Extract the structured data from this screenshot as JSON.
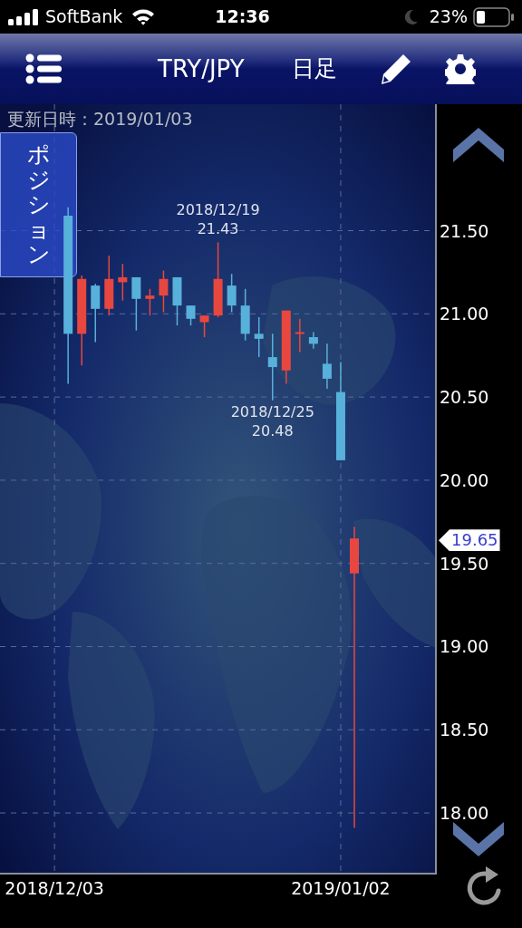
{
  "status_bar": {
    "carrier": "SoftBank",
    "time": "12:36",
    "battery": "23%"
  },
  "header": {
    "pair": "TRY/JPY",
    "timeframe": "日足"
  },
  "updated": "更新日時：2019/01/03",
  "position_tab": {
    "label": "ポジション"
  },
  "chart": {
    "chart_data": {
      "type": "candlestick",
      "ylim": [
        17.63,
        22.26
      ],
      "grid": true,
      "yticks": [
        {
          "value": 18,
          "label": "18.00"
        },
        {
          "value": 18.5,
          "label": "18.50"
        },
        {
          "value": 19,
          "label": "19.00"
        },
        {
          "value": 19.5,
          "label": "19.50"
        },
        {
          "value": 20,
          "label": "20.00"
        },
        {
          "value": 20.5,
          "label": "20.50"
        },
        {
          "value": 21,
          "label": "21.00"
        },
        {
          "value": 21.5,
          "label": "21.50"
        }
      ],
      "categories": [
        null,
        null,
        null,
        "2018/12/03",
        null,
        null,
        null,
        null,
        null,
        null,
        null,
        null,
        null,
        null,
        null,
        null,
        null,
        null,
        null,
        null,
        null,
        null,
        null,
        null,
        "2019/01/02",
        null
      ],
      "ohlc": [
        null,
        null,
        null,
        null,
        [
          21.59,
          21.64,
          20.58,
          20.88
        ],
        [
          20.88,
          21.23,
          20.69,
          21.21
        ],
        [
          21.17,
          21.18,
          20.83,
          21.03
        ],
        [
          21.03,
          21.35,
          20.99,
          21.21
        ],
        [
          21.19,
          21.3,
          21.08,
          21.22
        ],
        [
          21.22,
          21.22,
          20.9,
          21.09
        ],
        [
          21.09,
          21.15,
          20.99,
          21.11
        ],
        [
          21.11,
          21.26,
          21.01,
          21.21
        ],
        [
          21.22,
          21.22,
          20.93,
          21.05
        ],
        [
          21.05,
          21.05,
          20.93,
          20.97
        ],
        [
          20.95,
          20.99,
          20.86,
          20.99
        ],
        [
          20.99,
          21.43,
          20.98,
          21.21
        ],
        [
          21.17,
          21.24,
          21.01,
          21.05
        ],
        [
          21.05,
          21.15,
          20.84,
          20.88
        ],
        [
          20.88,
          20.98,
          20.74,
          20.85
        ],
        [
          20.74,
          20.88,
          20.48,
          20.68
        ],
        [
          20.66,
          21.02,
          20.58,
          21.02
        ],
        [
          20.88,
          20.97,
          20.77,
          20.89
        ],
        [
          20.86,
          20.89,
          20.79,
          20.82
        ],
        [
          20.7,
          20.82,
          20.55,
          20.61
        ],
        [
          20.53,
          20.71,
          20.12,
          20.12
        ],
        [
          19.44,
          19.72,
          17.91,
          19.65
        ]
      ],
      "annotations": [
        {
          "y": 21.43,
          "text": "2018/12/19"
        },
        {
          "y": 21.43,
          "text": "21.43"
        },
        {
          "y": 20.48,
          "text": "2018/12/25"
        },
        {
          "y": 20.48,
          "text": "20.48"
        }
      ]
    },
    "current_price": "19.65"
  }
}
